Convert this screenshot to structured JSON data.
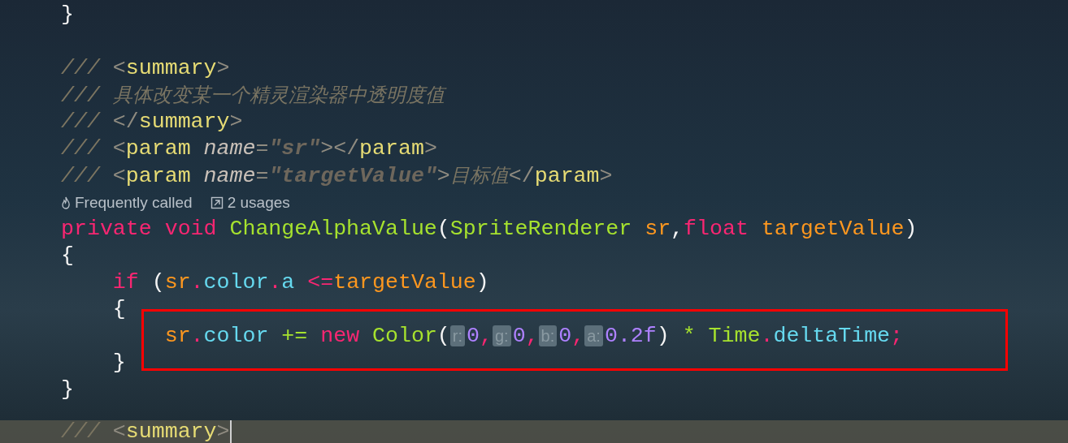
{
  "editor": {
    "lines": [
      {
        "kind": "code",
        "tokens": [
          {
            "t": "}",
            "kind": "punct"
          }
        ]
      },
      {
        "kind": "blank"
      },
      {
        "kind": "code",
        "tokens": [
          {
            "t": "/// ",
            "kind": "comment"
          },
          {
            "t": "<",
            "kind": "bracket"
          },
          {
            "t": "summary",
            "kind": "tag"
          },
          {
            "t": ">",
            "kind": "bracket"
          }
        ]
      },
      {
        "kind": "code",
        "tokens": [
          {
            "t": "/// ",
            "kind": "comment"
          },
          {
            "t": "具体改变某一个精灵渲染器中透明度值",
            "kind": "doc"
          }
        ]
      },
      {
        "kind": "code",
        "tokens": [
          {
            "t": "/// ",
            "kind": "comment"
          },
          {
            "t": "</",
            "kind": "bracket"
          },
          {
            "t": "summary",
            "kind": "tag"
          },
          {
            "t": ">",
            "kind": "bracket"
          }
        ]
      },
      {
        "kind": "code",
        "tokens": [
          {
            "t": "/// ",
            "kind": "comment"
          },
          {
            "t": "<",
            "kind": "bracket"
          },
          {
            "t": "param",
            "kind": "tag"
          },
          {
            "t": " name",
            "kind": "attr"
          },
          {
            "t": "=",
            "kind": "bracket"
          },
          {
            "t": "\"sr\"",
            "kind": "string"
          },
          {
            "t": "></",
            "kind": "bracket"
          },
          {
            "t": "param",
            "kind": "tag"
          },
          {
            "t": ">",
            "kind": "bracket"
          }
        ]
      },
      {
        "kind": "code",
        "tokens": [
          {
            "t": "/// ",
            "kind": "comment"
          },
          {
            "t": "<",
            "kind": "bracket"
          },
          {
            "t": "param",
            "kind": "tag"
          },
          {
            "t": " name",
            "kind": "attr"
          },
          {
            "t": "=",
            "kind": "bracket"
          },
          {
            "t": "\"targetValue\"",
            "kind": "string"
          },
          {
            "t": ">",
            "kind": "bracket"
          },
          {
            "t": "目标值",
            "kind": "doc"
          },
          {
            "t": "</",
            "kind": "bracket"
          },
          {
            "t": "param",
            "kind": "tag"
          },
          {
            "t": ">",
            "kind": "bracket"
          }
        ]
      },
      {
        "kind": "lens",
        "items": [
          {
            "label": "Frequently called"
          },
          {
            "label": "2 usages"
          }
        ]
      },
      {
        "kind": "code",
        "tokens": [
          {
            "t": "private ",
            "kind": "keyword"
          },
          {
            "t": "void ",
            "kind": "keyword"
          },
          {
            "t": "ChangeAlphaValue",
            "kind": "func"
          },
          {
            "t": "(",
            "kind": "punct"
          },
          {
            "t": "SpriteRenderer ",
            "kind": "func"
          },
          {
            "t": "sr",
            "kind": "param"
          },
          {
            "t": ",",
            "kind": "punct"
          },
          {
            "t": "float ",
            "kind": "keyword"
          },
          {
            "t": "targetValue",
            "kind": "param"
          },
          {
            "t": ")",
            "kind": "punct"
          }
        ]
      },
      {
        "kind": "code",
        "tokens": [
          {
            "t": "{",
            "kind": "punct"
          }
        ]
      },
      {
        "kind": "code",
        "tokens": [
          {
            "t": "    if",
            "kind": "keyword"
          },
          {
            "t": " (",
            "kind": "punct"
          },
          {
            "t": "sr",
            "kind": "param"
          },
          {
            "t": ".",
            "kind": "keyword"
          },
          {
            "t": "color",
            "kind": "prop"
          },
          {
            "t": ".",
            "kind": "keyword"
          },
          {
            "t": "a ",
            "kind": "prop"
          },
          {
            "t": "<=",
            "kind": "keyword"
          },
          {
            "t": "targetValue",
            "kind": "param"
          },
          {
            "t": ")",
            "kind": "punct"
          }
        ]
      },
      {
        "kind": "code",
        "tokens": [
          {
            "t": "    {",
            "kind": "punct"
          }
        ]
      },
      {
        "kind": "code",
        "highlighted": true,
        "tokens": [
          {
            "t": "        sr",
            "kind": "param"
          },
          {
            "t": ".",
            "kind": "keyword"
          },
          {
            "t": "color ",
            "kind": "prop"
          },
          {
            "t": "+= ",
            "kind": "func"
          },
          {
            "t": "new ",
            "kind": "keyword"
          },
          {
            "t": "Color",
            "kind": "func"
          },
          {
            "t": "(",
            "kind": "punct"
          },
          {
            "t": "r:",
            "kind": "hint"
          },
          {
            "t": "0",
            "kind": "number"
          },
          {
            "t": ",",
            "kind": "keyword"
          },
          {
            "t": "g:",
            "kind": "hint"
          },
          {
            "t": "0",
            "kind": "number"
          },
          {
            "t": ",",
            "kind": "keyword"
          },
          {
            "t": "b:",
            "kind": "hint"
          },
          {
            "t": "0",
            "kind": "number"
          },
          {
            "t": ",",
            "kind": "keyword"
          },
          {
            "t": "a:",
            "kind": "hint"
          },
          {
            "t": "0.2f",
            "kind": "number"
          },
          {
            "t": ") ",
            "kind": "punct"
          },
          {
            "t": "* ",
            "kind": "func"
          },
          {
            "t": "Time",
            "kind": "func"
          },
          {
            "t": ".",
            "kind": "keyword"
          },
          {
            "t": "deltaTime",
            "kind": "prop"
          },
          {
            "t": ";",
            "kind": "keyword"
          }
        ]
      },
      {
        "kind": "code",
        "tokens": [
          {
            "t": "    }",
            "kind": "punct"
          }
        ]
      },
      {
        "kind": "code",
        "tokens": [
          {
            "t": "}",
            "kind": "punct"
          }
        ]
      },
      {
        "kind": "blank"
      },
      {
        "kind": "code",
        "current": true,
        "tokens": [
          {
            "t": "/// ",
            "kind": "comment"
          },
          {
            "t": "<",
            "kind": "bracket"
          },
          {
            "t": "summary",
            "kind": "tag"
          },
          {
            "t": ">",
            "kind": "bracket"
          }
        ]
      }
    ]
  }
}
